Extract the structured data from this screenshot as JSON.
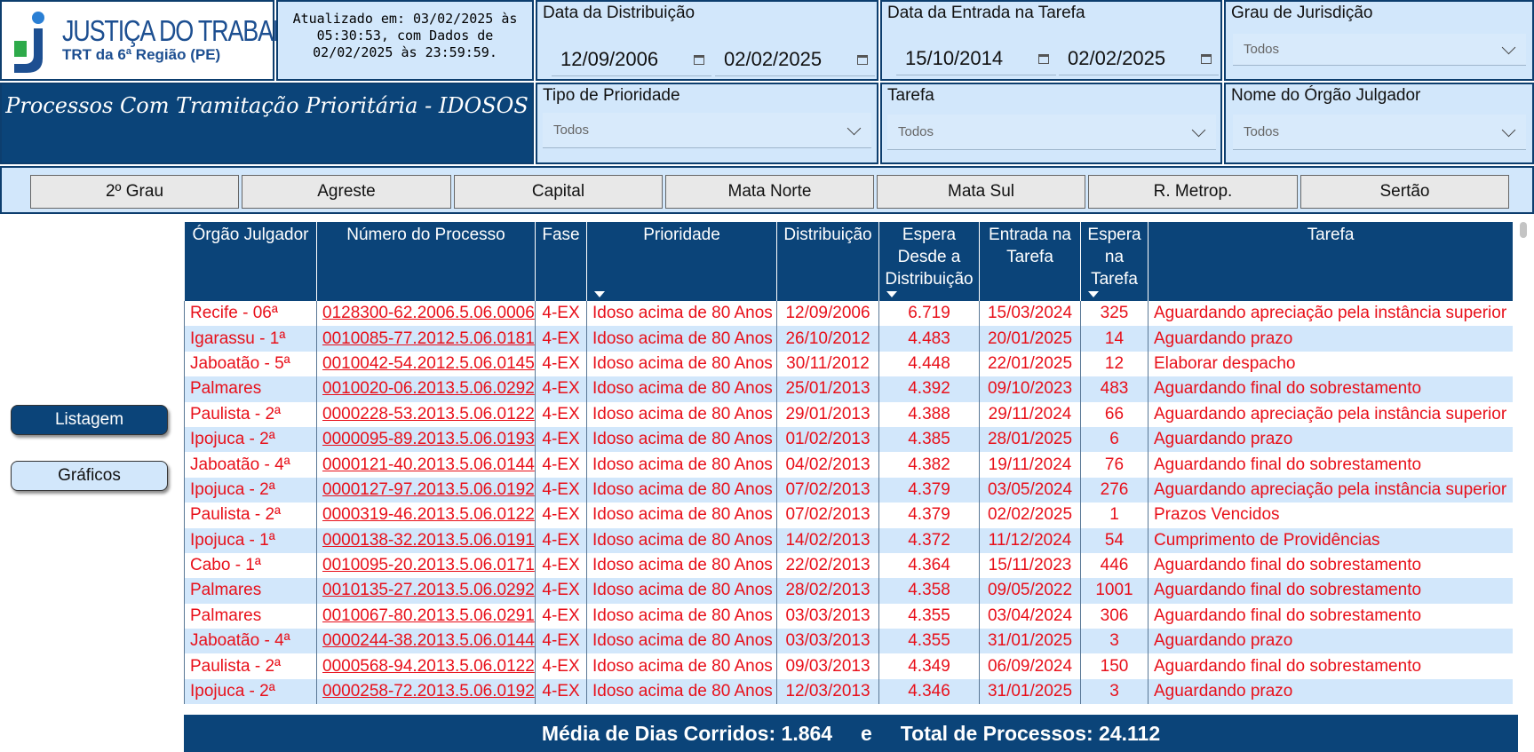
{
  "logo": {
    "title": "JUSTIÇA DO TRABALHO",
    "subtitle": "TRT da 6ª Região (PE)"
  },
  "updated_text": "Atualizado em: 03/02/2025 às 05:30:53, com Dados de 02/02/2025 às 23:59:59.",
  "page_title": "Processos Com Tramitação Prioritária - IDOSOS",
  "filters": {
    "data_distribuicao": {
      "label": "Data da Distribuição",
      "start": "12/09/2006",
      "end": "02/02/2025"
    },
    "data_entrada": {
      "label": "Data da Entrada na Tarefa",
      "start": "15/10/2014",
      "end": "02/02/2025"
    },
    "grau": {
      "label": "Grau de Jurisdição",
      "value": "Todos"
    },
    "prioridade": {
      "label": "Tipo de Prioridade",
      "value": "Todos"
    },
    "tarefa": {
      "label": "Tarefa",
      "value": "Todos"
    },
    "orgao": {
      "label": "Nome do Órgão Julgador",
      "value": "Todos"
    }
  },
  "regions": [
    "2º Grau",
    "Agreste",
    "Capital",
    "Mata Norte",
    "Mata Sul",
    "R. Metrop.",
    "Sertão"
  ],
  "nav": {
    "listagem": "Listagem",
    "graficos": "Gráficos"
  },
  "table": {
    "headers": [
      "Órgão Julgador",
      "Número do Processo",
      "Fase",
      "Prioridade",
      "Distribuição",
      "Espera Desde a Distribuição",
      "Entrada na Tarefa",
      "Espera na Tarefa",
      "Tarefa"
    ],
    "rows": [
      [
        "Recife - 06ª",
        "0128300-62.2006.5.06.0006",
        "4-EX",
        "Idoso acima de 80 Anos",
        "12/09/2006",
        "6.719",
        "15/03/2024",
        "325",
        "Aguardando apreciação pela instância superior"
      ],
      [
        "Igarassu - 1ª",
        "0010085-77.2012.5.06.0181",
        "4-EX",
        "Idoso acima de 80 Anos",
        "26/10/2012",
        "4.483",
        "20/01/2025",
        "14",
        "Aguardando prazo"
      ],
      [
        "Jaboatão - 5ª",
        "0010042-54.2012.5.06.0145",
        "4-EX",
        "Idoso acima de 80 Anos",
        "30/11/2012",
        "4.448",
        "22/01/2025",
        "12",
        "Elaborar despacho"
      ],
      [
        "Palmares",
        "0010020-06.2013.5.06.0292",
        "4-EX",
        "Idoso acima de 80 Anos",
        "25/01/2013",
        "4.392",
        "09/10/2023",
        "483",
        "Aguardando final do sobrestamento"
      ],
      [
        "Paulista - 2ª",
        "0000228-53.2013.5.06.0122",
        "4-EX",
        "Idoso acima de 80 Anos",
        "29/01/2013",
        "4.388",
        "29/11/2024",
        "66",
        "Aguardando apreciação pela instância superior"
      ],
      [
        "Ipojuca - 2ª",
        "0000095-89.2013.5.06.0193",
        "4-EX",
        "Idoso acima de 80 Anos",
        "01/02/2013",
        "4.385",
        "28/01/2025",
        "6",
        "Aguardando prazo"
      ],
      [
        "Jaboatão - 4ª",
        "0000121-40.2013.5.06.0144",
        "4-EX",
        "Idoso acima de 80 Anos",
        "04/02/2013",
        "4.382",
        "19/11/2024",
        "76",
        "Aguardando final do sobrestamento"
      ],
      [
        "Ipojuca - 2ª",
        "0000127-97.2013.5.06.0192",
        "4-EX",
        "Idoso acima de 80 Anos",
        "07/02/2013",
        "4.379",
        "03/05/2024",
        "276",
        "Aguardando apreciação pela instância superior"
      ],
      [
        "Paulista - 2ª",
        "0000319-46.2013.5.06.0122",
        "4-EX",
        "Idoso acima de 80 Anos",
        "07/02/2013",
        "4.379",
        "02/02/2025",
        "1",
        "Prazos Vencidos"
      ],
      [
        "Ipojuca - 1ª",
        "0000138-32.2013.5.06.0191",
        "4-EX",
        "Idoso acima de 80 Anos",
        "14/02/2013",
        "4.372",
        "11/12/2024",
        "54",
        "Cumprimento de Providências"
      ],
      [
        "Cabo - 1ª",
        "0010095-20.2013.5.06.0171",
        "4-EX",
        "Idoso acima de 80 Anos",
        "22/02/2013",
        "4.364",
        "15/11/2023",
        "446",
        "Aguardando final do sobrestamento"
      ],
      [
        "Palmares",
        "0010135-27.2013.5.06.0292",
        "4-EX",
        "Idoso acima de 80 Anos",
        "28/02/2013",
        "4.358",
        "09/05/2022",
        "1001",
        "Aguardando final do sobrestamento"
      ],
      [
        "Palmares",
        "0010067-80.2013.5.06.0291",
        "4-EX",
        "Idoso acima de 80 Anos",
        "03/03/2013",
        "4.355",
        "03/04/2024",
        "306",
        "Aguardando final do sobrestamento"
      ],
      [
        "Jaboatão - 4ª",
        "0000244-38.2013.5.06.0144",
        "4-EX",
        "Idoso acima de 80 Anos",
        "03/03/2013",
        "4.355",
        "31/01/2025",
        "3",
        "Aguardando prazo"
      ],
      [
        "Paulista - 2ª",
        "0000568-94.2013.5.06.0122",
        "4-EX",
        "Idoso acima de 80 Anos",
        "09/03/2013",
        "4.349",
        "06/09/2024",
        "150",
        "Aguardando final do sobrestamento"
      ],
      [
        "Ipojuca - 2ª",
        "0000258-72.2013.5.06.0192",
        "4-EX",
        "Idoso acima de 80 Anos",
        "12/03/2013",
        "4.346",
        "31/01/2025",
        "3",
        "Aguardando prazo"
      ]
    ]
  },
  "footer": {
    "media_label": "Média de Dias Corridos: 1.864",
    "separator": "e",
    "total_label": "Total de Processos: 24.112"
  },
  "colors": {
    "header_blue": "#0b4479",
    "light_blue": "#d2e7fb",
    "row_text_red": "#e8101a"
  }
}
